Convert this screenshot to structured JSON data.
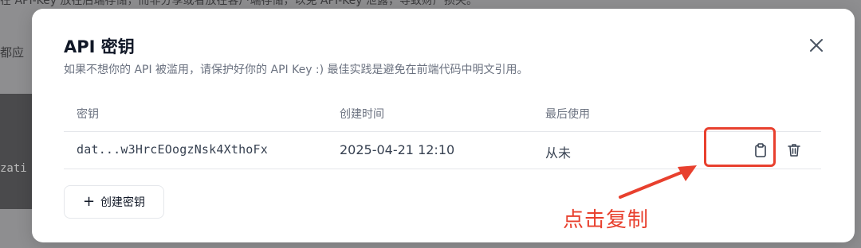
{
  "background": {
    "top_text": "在  API-Key  放在后端存储，而非分享或者放在客户端存储，以免  API-Key  泄露，导致财产损失。",
    "side_text": "都应",
    "dark_text": "zati"
  },
  "modal": {
    "title": "API 密钥",
    "subtitle": "如果不想你的 API 被滥用，请保护好你的 API Key :) 最佳实践是避免在前端代码中明文引用。",
    "table": {
      "headers": {
        "key": "密钥",
        "created": "创建时间",
        "last_used": "最后使用"
      },
      "rows": [
        {
          "key": "dat...w3HrcEOogzNsk4XthoFx",
          "created": "2025-04-21 12:10",
          "last_used": "从未"
        }
      ]
    },
    "create_button_label": "创建密钥",
    "create_button_icon": "+"
  },
  "annotation": {
    "text": "点击复制",
    "color": "#e8402e"
  },
  "icons": [
    "close-icon",
    "copy-icon",
    "trash-icon",
    "plus-icon"
  ]
}
